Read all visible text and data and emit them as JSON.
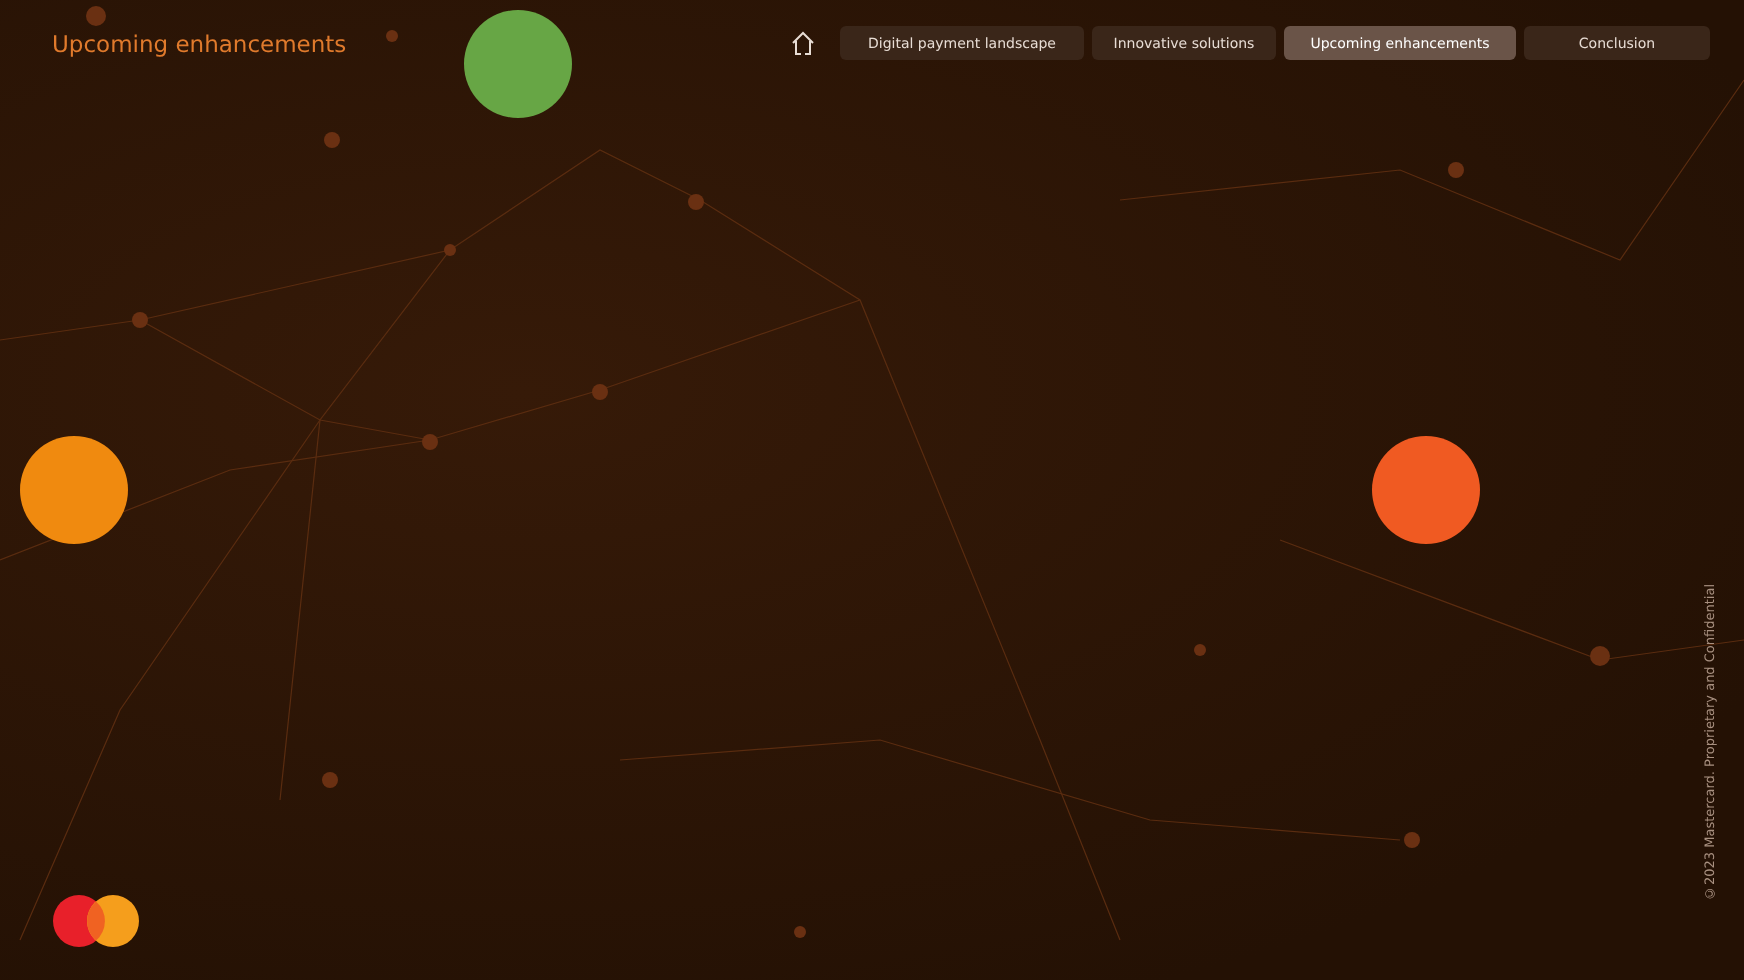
{
  "page_title": "Upcoming enhancements",
  "nav": [
    {
      "label": "Digital payment landscape",
      "selected": false
    },
    {
      "label": "Innovative solutions",
      "selected": false
    },
    {
      "label": "Upcoming enhancements",
      "selected": true
    },
    {
      "label": "Conclusion",
      "selected": false
    }
  ],
  "markers": [
    {
      "color": "#67a645"
    },
    {
      "color": "#f08a0f"
    },
    {
      "color": "#f05a22"
    }
  ],
  "footer_note": "©2023 Mastercard. Proprietary and Confidential"
}
